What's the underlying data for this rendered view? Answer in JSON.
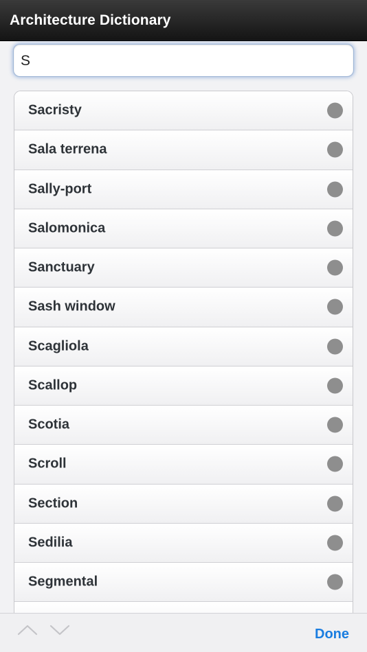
{
  "header": {
    "title": "Architecture Dictionary"
  },
  "search": {
    "value": "S"
  },
  "list": {
    "items": [
      {
        "label": "Sacristy"
      },
      {
        "label": "Sala terrena"
      },
      {
        "label": "Sally-port"
      },
      {
        "label": "Salomonica"
      },
      {
        "label": "Sanctuary"
      },
      {
        "label": "Sash window"
      },
      {
        "label": "Scagliola"
      },
      {
        "label": "Scallop"
      },
      {
        "label": "Scotia"
      },
      {
        "label": "Scroll"
      },
      {
        "label": "Section"
      },
      {
        "label": "Sedilia"
      },
      {
        "label": "Segmental"
      },
      {
        "label": ""
      }
    ]
  },
  "toolbar": {
    "prev_icon": "chevron-up-icon",
    "next_icon": "chevron-down-icon",
    "done_label": "Done"
  },
  "colors": {
    "accent": "#1a7de0",
    "disclosure_dot": "#8e8e8e",
    "titlebar": "#1c1c1c"
  }
}
